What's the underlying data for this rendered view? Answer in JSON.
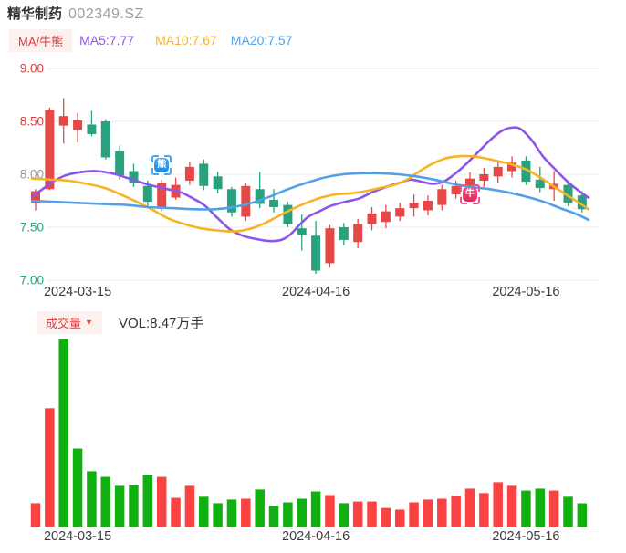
{
  "header": {
    "title": "精华制药",
    "code": "002349.SZ"
  },
  "legend": {
    "mode_chip": "MA/牛熊",
    "ma5": "MA5:7.77",
    "ma10": "MA10:7.67",
    "ma20": "MA20:7.57"
  },
  "volume_header": {
    "chip": "成交量",
    "caret": "▼",
    "vol_label": "VOL:8.47万手"
  },
  "colors": {
    "up": "#e64848",
    "down": "#2aa17e",
    "vol_up": "#fa4242",
    "vol_down": "#11b011",
    "ma5": "#8d55ea",
    "ma10": "#f8b323",
    "ma20": "#54a0e8",
    "grid": "#ededf3",
    "baseline": "#e9e9e9",
    "tick_red": "#e23d3d",
    "tick_gray": "#999999",
    "tick_green": "#26a37c",
    "chip_text": "#e23d3d",
    "chip_bg": "#fdf1f0",
    "title_text": "#333333",
    "code_text": "#9aa0a6",
    "date_text": "#3c3c3c",
    "bear_badge": "#1f87e5",
    "bear_bracket": "#45aaf4",
    "bull_badge": "#e42555",
    "bull_bracket": "#f2558b"
  },
  "chart_data": {
    "type": "candlestick+volume",
    "title": "精华制药 002349.SZ 日K",
    "legend_position": "top",
    "grid": true,
    "price_axis": {
      "range": [
        7.0,
        9.0
      ],
      "ticks": [
        {
          "label": "9.00",
          "value": 9.0,
          "color": "#e23d3d"
        },
        {
          "label": "8.50",
          "value": 8.5,
          "color": "#e23d3d"
        },
        {
          "label": "8.00",
          "value": 8.0,
          "color": "#999999"
        },
        {
          "label": "7.50",
          "value": 7.5,
          "color": "#26a37c"
        },
        {
          "label": "7.00",
          "value": 7.0,
          "color": "#26a37c"
        }
      ]
    },
    "x_axis": {
      "labels": [
        {
          "text": "2024-03-15",
          "index": 3
        },
        {
          "text": "2024-04-16",
          "index": 20
        },
        {
          "text": "2024-05-16",
          "index": 35
        }
      ]
    },
    "ma_values": {
      "MA5": 7.77,
      "MA10": 7.67,
      "MA20": 7.57
    },
    "candles": [
      {
        "o": 7.73,
        "h": 7.86,
        "l": 7.66,
        "c": 7.84
      },
      {
        "o": 7.86,
        "h": 8.63,
        "l": 7.85,
        "c": 8.61
      },
      {
        "o": 8.46,
        "h": 8.72,
        "l": 8.29,
        "c": 8.55
      },
      {
        "o": 8.42,
        "h": 8.58,
        "l": 8.3,
        "c": 8.51
      },
      {
        "o": 8.47,
        "h": 8.6,
        "l": 8.36,
        "c": 8.38
      },
      {
        "o": 8.5,
        "h": 8.52,
        "l": 8.14,
        "c": 8.16
      },
      {
        "o": 8.22,
        "h": 8.27,
        "l": 7.95,
        "c": 7.99
      },
      {
        "o": 8.03,
        "h": 8.1,
        "l": 7.88,
        "c": 7.92
      },
      {
        "o": 7.89,
        "h": 7.94,
        "l": 7.7,
        "c": 7.74
      },
      {
        "o": 7.69,
        "h": 7.95,
        "l": 7.65,
        "c": 7.92
      },
      {
        "o": 7.78,
        "h": 7.97,
        "l": 7.76,
        "c": 7.9
      },
      {
        "o": 7.94,
        "h": 8.12,
        "l": 7.9,
        "c": 8.07
      },
      {
        "o": 8.1,
        "h": 8.14,
        "l": 7.85,
        "c": 7.89
      },
      {
        "o": 7.98,
        "h": 8.02,
        "l": 7.82,
        "c": 7.86
      },
      {
        "o": 7.86,
        "h": 7.88,
        "l": 7.6,
        "c": 7.64
      },
      {
        "o": 7.6,
        "h": 7.92,
        "l": 7.56,
        "c": 7.89
      },
      {
        "o": 7.86,
        "h": 8.02,
        "l": 7.68,
        "c": 7.72
      },
      {
        "o": 7.76,
        "h": 7.86,
        "l": 7.64,
        "c": 7.69
      },
      {
        "o": 7.71,
        "h": 7.74,
        "l": 7.5,
        "c": 7.53
      },
      {
        "o": 7.49,
        "h": 7.62,
        "l": 7.28,
        "c": 7.43
      },
      {
        "o": 7.42,
        "h": 7.56,
        "l": 7.06,
        "c": 7.09
      },
      {
        "o": 7.16,
        "h": 7.52,
        "l": 7.12,
        "c": 7.49
      },
      {
        "o": 7.5,
        "h": 7.54,
        "l": 7.33,
        "c": 7.38
      },
      {
        "o": 7.36,
        "h": 7.58,
        "l": 7.3,
        "c": 7.53
      },
      {
        "o": 7.53,
        "h": 7.69,
        "l": 7.47,
        "c": 7.63
      },
      {
        "o": 7.55,
        "h": 7.71,
        "l": 7.49,
        "c": 7.65
      },
      {
        "o": 7.6,
        "h": 7.73,
        "l": 7.56,
        "c": 7.68
      },
      {
        "o": 7.68,
        "h": 7.81,
        "l": 7.6,
        "c": 7.73
      },
      {
        "o": 7.66,
        "h": 7.8,
        "l": 7.61,
        "c": 7.75
      },
      {
        "o": 7.71,
        "h": 7.9,
        "l": 7.66,
        "c": 7.86
      },
      {
        "o": 7.81,
        "h": 7.94,
        "l": 7.77,
        "c": 7.89
      },
      {
        "o": 7.88,
        "h": 8.02,
        "l": 7.82,
        "c": 7.96
      },
      {
        "o": 7.94,
        "h": 8.06,
        "l": 7.88,
        "c": 8.0
      },
      {
        "o": 7.98,
        "h": 8.12,
        "l": 7.92,
        "c": 8.07
      },
      {
        "o": 8.03,
        "h": 8.17,
        "l": 7.97,
        "c": 8.11
      },
      {
        "o": 8.13,
        "h": 8.17,
        "l": 7.9,
        "c": 7.93
      },
      {
        "o": 7.95,
        "h": 8.07,
        "l": 7.83,
        "c": 7.87
      },
      {
        "o": 7.86,
        "h": 8.03,
        "l": 7.75,
        "c": 7.91
      },
      {
        "o": 7.9,
        "h": 7.93,
        "l": 7.7,
        "c": 7.73
      },
      {
        "o": 7.8,
        "h": 7.84,
        "l": 7.64,
        "c": 7.67
      }
    ],
    "ma_lines": [
      {
        "name": "MA5",
        "color_key": "ma5",
        "points": [
          [
            35,
            7.79
          ],
          [
            45,
            7.85
          ],
          [
            58,
            7.93
          ],
          [
            72,
            7.99
          ],
          [
            88,
            8.02
          ],
          [
            105,
            8.03
          ],
          [
            122,
            8.01
          ],
          [
            138,
            7.97
          ],
          [
            152,
            7.93
          ],
          [
            168,
            7.89
          ],
          [
            183,
            7.86
          ],
          [
            198,
            7.83
          ],
          [
            212,
            7.77
          ],
          [
            225,
            7.7
          ],
          [
            238,
            7.59
          ],
          [
            252,
            7.48
          ],
          [
            266,
            7.42
          ],
          [
            280,
            7.39
          ],
          [
            295,
            7.37
          ],
          [
            308,
            7.38
          ],
          [
            318,
            7.43
          ],
          [
            328,
            7.52
          ],
          [
            338,
            7.6
          ],
          [
            350,
            7.65
          ],
          [
            362,
            7.7
          ],
          [
            378,
            7.74
          ],
          [
            393,
            7.77
          ],
          [
            408,
            7.83
          ],
          [
            423,
            7.88
          ],
          [
            438,
            7.92
          ],
          [
            450,
            7.95
          ],
          [
            462,
            7.93
          ],
          [
            474,
            7.91
          ],
          [
            486,
            7.93
          ],
          [
            498,
            8.0
          ],
          [
            510,
            8.09
          ],
          [
            524,
            8.21
          ],
          [
            538,
            8.33
          ],
          [
            550,
            8.41
          ],
          [
            560,
            8.44
          ],
          [
            570,
            8.43
          ],
          [
            582,
            8.33
          ],
          [
            595,
            8.17
          ],
          [
            608,
            8.05
          ],
          [
            622,
            7.93
          ],
          [
            635,
            7.84
          ],
          [
            645,
            7.78
          ]
        ]
      },
      {
        "name": "MA10",
        "color_key": "ma10",
        "points": [
          [
            35,
            7.96
          ],
          [
            55,
            7.95
          ],
          [
            75,
            7.94
          ],
          [
            95,
            7.91
          ],
          [
            115,
            7.87
          ],
          [
            132,
            7.81
          ],
          [
            150,
            7.74
          ],
          [
            168,
            7.66
          ],
          [
            185,
            7.58
          ],
          [
            202,
            7.53
          ],
          [
            220,
            7.49
          ],
          [
            238,
            7.47
          ],
          [
            256,
            7.46
          ],
          [
            272,
            7.48
          ],
          [
            288,
            7.53
          ],
          [
            304,
            7.6
          ],
          [
            320,
            7.67
          ],
          [
            336,
            7.73
          ],
          [
            352,
            7.78
          ],
          [
            368,
            7.81
          ],
          [
            384,
            7.82
          ],
          [
            400,
            7.84
          ],
          [
            416,
            7.87
          ],
          [
            432,
            7.9
          ],
          [
            446,
            7.95
          ],
          [
            460,
            8.03
          ],
          [
            474,
            8.1
          ],
          [
            488,
            8.15
          ],
          [
            502,
            8.17
          ],
          [
            518,
            8.17
          ],
          [
            532,
            8.15
          ],
          [
            548,
            8.12
          ],
          [
            562,
            8.09
          ],
          [
            578,
            8.04
          ],
          [
            592,
            7.97
          ],
          [
            606,
            7.89
          ],
          [
            620,
            7.81
          ],
          [
            633,
            7.74
          ],
          [
            645,
            7.67
          ]
        ]
      },
      {
        "name": "MA20",
        "color_key": "ma20",
        "points": [
          [
            35,
            7.75
          ],
          [
            60,
            7.74
          ],
          [
            85,
            7.73
          ],
          [
            112,
            7.72
          ],
          [
            138,
            7.71
          ],
          [
            163,
            7.69
          ],
          [
            188,
            7.68
          ],
          [
            213,
            7.67
          ],
          [
            235,
            7.67
          ],
          [
            256,
            7.69
          ],
          [
            276,
            7.73
          ],
          [
            296,
            7.79
          ],
          [
            316,
            7.86
          ],
          [
            336,
            7.92
          ],
          [
            356,
            7.97
          ],
          [
            376,
            8.0
          ],
          [
            396,
            8.01
          ],
          [
            416,
            8.01
          ],
          [
            436,
            8.0
          ],
          [
            456,
            7.98
          ],
          [
            476,
            7.95
          ],
          [
            496,
            7.91
          ],
          [
            516,
            7.88
          ],
          [
            536,
            7.86
          ],
          [
            556,
            7.83
          ],
          [
            576,
            7.79
          ],
          [
            596,
            7.74
          ],
          [
            614,
            7.68
          ],
          [
            630,
            7.63
          ],
          [
            645,
            7.57
          ]
        ]
      }
    ],
    "volume": {
      "unit": "万手",
      "last_label": "VOL:8.47万手",
      "bars": [
        {
          "v": 8.5,
          "dir": "up"
        },
        {
          "v": 42.4,
          "dir": "up"
        },
        {
          "v": 67.1,
          "dir": "down"
        },
        {
          "v": 28.0,
          "dir": "down"
        },
        {
          "v": 19.9,
          "dir": "down"
        },
        {
          "v": 17.9,
          "dir": "down"
        },
        {
          "v": 14.7,
          "dir": "down"
        },
        {
          "v": 15.0,
          "dir": "down"
        },
        {
          "v": 18.6,
          "dir": "down"
        },
        {
          "v": 17.9,
          "dir": "up"
        },
        {
          "v": 10.4,
          "dir": "up"
        },
        {
          "v": 14.7,
          "dir": "up"
        },
        {
          "v": 10.8,
          "dir": "down"
        },
        {
          "v": 8.5,
          "dir": "down"
        },
        {
          "v": 9.8,
          "dir": "down"
        },
        {
          "v": 10.1,
          "dir": "up"
        },
        {
          "v": 13.4,
          "dir": "down"
        },
        {
          "v": 7.5,
          "dir": "down"
        },
        {
          "v": 8.8,
          "dir": "down"
        },
        {
          "v": 10.1,
          "dir": "down"
        },
        {
          "v": 12.7,
          "dir": "down"
        },
        {
          "v": 11.4,
          "dir": "up"
        },
        {
          "v": 8.5,
          "dir": "down"
        },
        {
          "v": 9.1,
          "dir": "up"
        },
        {
          "v": 9.1,
          "dir": "up"
        },
        {
          "v": 6.8,
          "dir": "up"
        },
        {
          "v": 6.2,
          "dir": "up"
        },
        {
          "v": 8.8,
          "dir": "up"
        },
        {
          "v": 9.8,
          "dir": "up"
        },
        {
          "v": 10.1,
          "dir": "up"
        },
        {
          "v": 11.1,
          "dir": "up"
        },
        {
          "v": 13.7,
          "dir": "up"
        },
        {
          "v": 12.1,
          "dir": "up"
        },
        {
          "v": 16.0,
          "dir": "up"
        },
        {
          "v": 14.7,
          "dir": "up"
        },
        {
          "v": 13.0,
          "dir": "down"
        },
        {
          "v": 13.7,
          "dir": "down"
        },
        {
          "v": 13.0,
          "dir": "up"
        },
        {
          "v": 10.8,
          "dir": "down"
        },
        {
          "v": 8.47,
          "dir": "down"
        }
      ]
    },
    "markers": [
      {
        "name": "bear",
        "glyph": "熊",
        "index": 9,
        "price": 8.09
      },
      {
        "name": "bull",
        "glyph": "牛",
        "index": 31,
        "price": 7.81
      }
    ]
  }
}
